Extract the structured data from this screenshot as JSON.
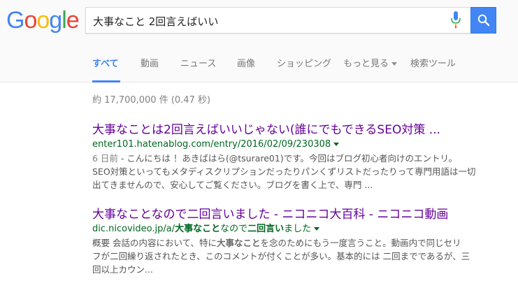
{
  "search": {
    "query": "大事なこと 2回言えばいい"
  },
  "logo": {
    "letters": [
      "G",
      "o",
      "o",
      "g",
      "l",
      "e"
    ],
    "colors": [
      "#4285f4",
      "#ea4335",
      "#fbbc05",
      "#4285f4",
      "#34a853",
      "#ea4335"
    ]
  },
  "tabs": [
    {
      "label": "すべて"
    },
    {
      "label": "動画"
    },
    {
      "label": "ニュース"
    },
    {
      "label": "画像"
    },
    {
      "label": "ショッピング"
    },
    {
      "label": "もっと見る"
    },
    {
      "label": "検索ツール"
    }
  ],
  "stats": "約 17,700,000 件 (0.47 秒)",
  "results": [
    {
      "title": "大事なことは2回言えばいいじゃない(誰にでもできるSEO対策 ...",
      "url": "enter101.hatenablog.com/entry/2016/02/09/230308",
      "date": "6 日前",
      "snippet_1": " - こんにちは ！あきばはら(@tsurare01)です。今回はブログ初心者向けのエントリ。",
      "snippet_2": "SEO対策といってもメタディスクリプションだったりパンくずリストだったりって専門用語は一切",
      "snippet_3": "出てきませんので、安心してご覧ください。ブログを書く上で、専門 ..."
    },
    {
      "title": "大事なことなので二回言いました - ニコニコ大百科 - ニコニコ動画",
      "url_prefix": "dic.nicovideo.jp/a/",
      "url_bold_1": "大事なこと",
      "url_mid": "なので",
      "url_bold_2": "二回言い",
      "url_suffix": "ました",
      "snippet_a": "概要 会話の内容において、特に",
      "snippet_b": "大事なこと",
      "snippet_c": "を念のためにもう一度言うこと。動画内で同じセリ",
      "snippet_2": "フが二回繰り返されたとき、このコメントが付くことが多い。基本的には 二回までであるが、三",
      "snippet_3": "回以上カウン..."
    }
  ]
}
